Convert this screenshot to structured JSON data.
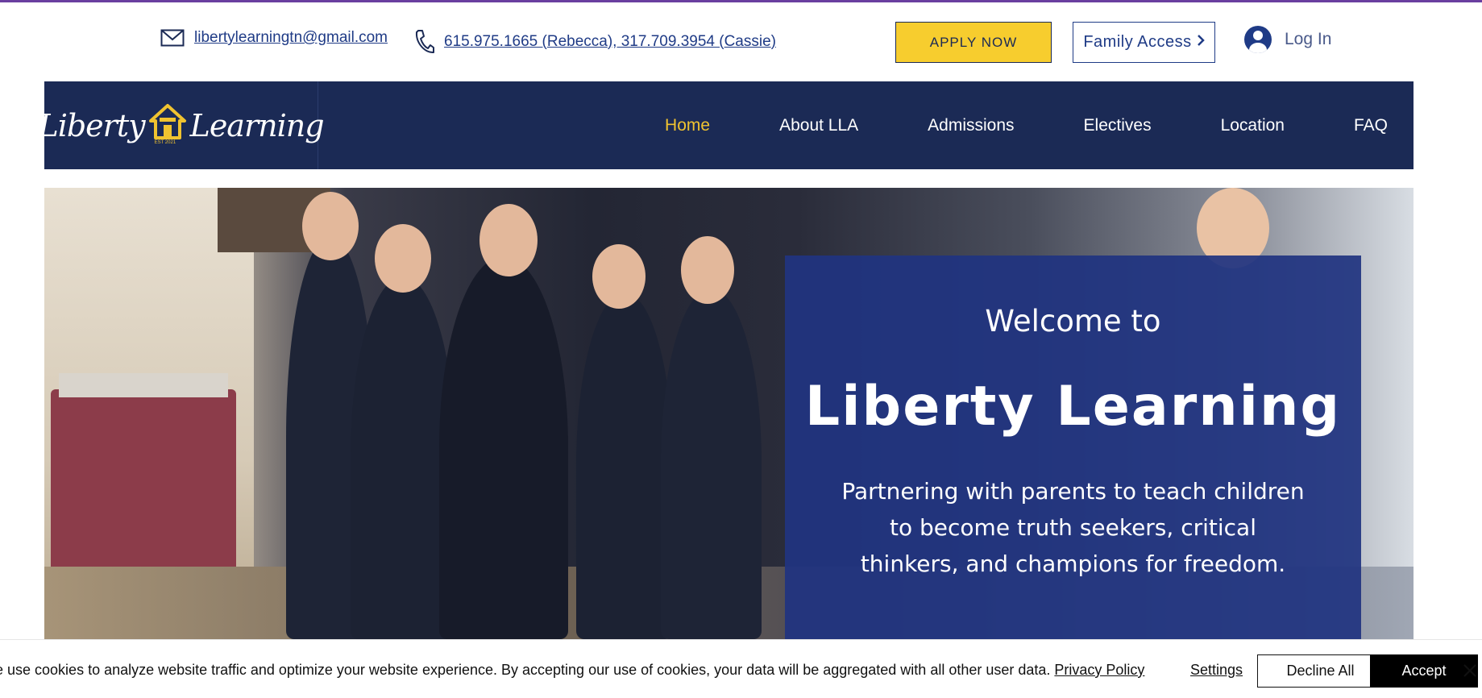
{
  "contact": {
    "email": "libertylearningtn@gmail.com",
    "phone_prefix": "615.975.1665 (",
    "phone_name1": "Rebecca",
    "phone_mid": "), 317.709.3954 (",
    "phone_name2": "Cassie",
    "phone_suffix": ")"
  },
  "header": {
    "apply_label": "APPLY NOW",
    "family_label": "Family Access",
    "login_label": "Log In"
  },
  "logo": {
    "left_word": "Liberty",
    "right_word": "Learning",
    "est": "EST 2021"
  },
  "nav": {
    "items": [
      {
        "label": "Home",
        "active": true
      },
      {
        "label": "About LLA"
      },
      {
        "label": "Admissions"
      },
      {
        "label": "Electives"
      },
      {
        "label": "Location"
      },
      {
        "label": "FAQ"
      }
    ]
  },
  "hero": {
    "welcome": "Welcome to",
    "title": "Liberty Learning",
    "tagline": "Partnering with parents to teach children to become truth seekers, critical thinkers, and champions for freedom."
  },
  "cookie": {
    "text": "e use cookies to analyze website traffic and optimize your website experience. By accepting our use of cookies, your data will be aggregated with all other user data. ",
    "policy_link": "Privacy Policy",
    "settings": "Settings",
    "decline": "Decline All",
    "accept": "Accept"
  },
  "colors": {
    "navy": "#1b2a55",
    "accent_yellow": "#f7cd2e",
    "overlay_blue": "#203480",
    "link_blue": "#1f3b86"
  },
  "icons": [
    "envelope-icon",
    "phone-icon",
    "chevron-right-icon",
    "user-avatar-icon",
    "house-logo-icon",
    "close-icon"
  ]
}
